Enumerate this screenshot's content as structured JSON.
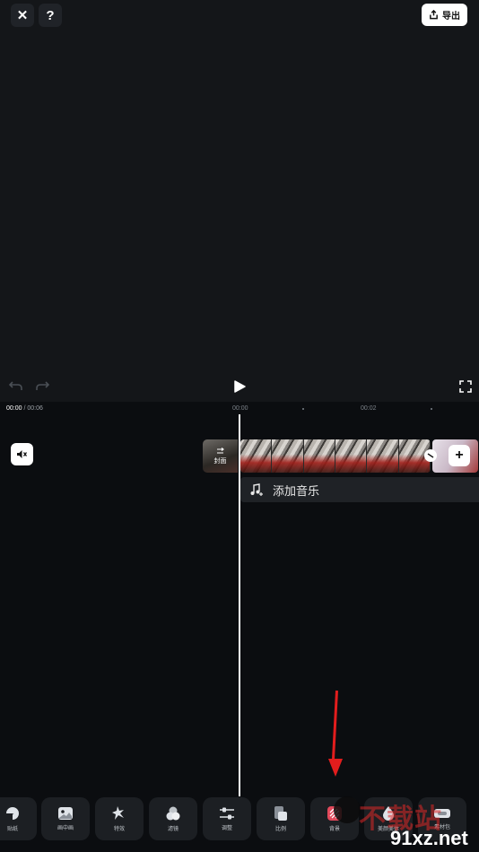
{
  "header": {
    "export_label": "导出"
  },
  "timeline": {
    "current_time": "00:00",
    "total_time": "/ 00:06",
    "ruler_label_1": "00:00",
    "ruler_label_2": "00:02",
    "cover_label": "封面",
    "music_label": "添加音乐"
  },
  "toolbar": {
    "items": [
      {
        "label": "贴纸",
        "icon": "sticker-icon"
      },
      {
        "label": "画中画",
        "icon": "picture-in-picture-icon"
      },
      {
        "label": "特效",
        "icon": "effects-icon"
      },
      {
        "label": "滤镜",
        "icon": "filter-icon"
      },
      {
        "label": "调整",
        "icon": "adjust-icon"
      },
      {
        "label": "比例",
        "icon": "ratio-icon"
      },
      {
        "label": "背景",
        "icon": "background-icon"
      },
      {
        "label": "美颜美体",
        "icon": "beauty-icon"
      },
      {
        "label": "素材包",
        "icon": "material-pack-icon"
      }
    ]
  },
  "watermark": {
    "text": "不载站",
    "url": "91xz.net"
  },
  "colors": {
    "accent_arrow": "#e21d1d"
  }
}
